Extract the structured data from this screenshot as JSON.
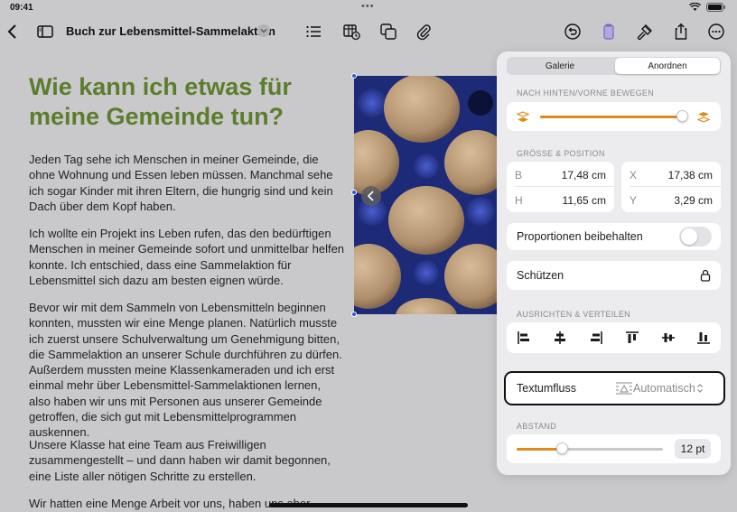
{
  "status": {
    "time": "09:41"
  },
  "toolbar": {
    "doc_title": "Buch zur Lebensmittel-Sammelaktion"
  },
  "document": {
    "heading": "Wie kann ich etwas für meine Gemeinde tun?",
    "paragraphs": [
      "Jeden Tag sehe ich Menschen in meiner Gemeinde, die ohne Wohnung und Essen leben müssen. Manchmal sehe ich sogar Kinder mit ihren Eltern, die hungrig sind und kein Dach über dem Kopf haben.",
      "Ich wollte ein Projekt ins Leben rufen, das den bedürftigen Menschen in meiner Gemeinde sofort und unmittelbar helfen konnte. Ich entschied, dass eine Sammelaktion für Lebensmittel sich dazu am besten eignen würde.",
      "Bevor wir mit dem Sammeln von Lebensmitteln beginnen konnten, mussten wir eine Menge planen. Natürlich musste ich zuerst unsere Schulverwaltung um Genehmigung bitten, die Sammelaktion an unserer Schule durchführen zu dürfen. Außerdem mussten meine Klassenkameraden und ich erst einmal mehr über Lebensmittel-Sammelaktionen lernen, also haben wir uns mit Personen aus unserer Gemeinde getroffen, die sich gut mit Lebensmittelprogrammen auskennen.",
      "Unsere Klasse hat eine Team aus Freiwilligen zusammengestellt – und dann haben wir damit begonnen, eine Liste aller nötigen Schritte zu erstellen.",
      "Wir hatten eine Menge Arbeit vor uns, haben uns aber"
    ]
  },
  "panel": {
    "tabs": {
      "gallery": "Galerie",
      "arrange": "Anordnen"
    },
    "move_label": "NACH HINTEN/VORNE BEWEGEN",
    "move_slider": 0.97,
    "size_label": "GRÖSSE & POSITION",
    "size": {
      "b_label": "B",
      "b_value": "17,48 cm",
      "h_label": "H",
      "h_value": "11,65 cm",
      "x_label": "X",
      "x_value": "17,38 cm",
      "y_label": "Y",
      "y_value": "3,29 cm"
    },
    "proportions_label": "Proportionen beibehalten",
    "proportions_on": false,
    "protect_label": "Schützen",
    "align_label": "AUSRICHTEN & VERTEILEN",
    "textflow_label": "Textumfluss",
    "textflow_value": "Automatisch",
    "spacing_label": "ABSTAND",
    "spacing_value": "12 pt",
    "spacing_slider": 0.31,
    "accent": "#e08a1a"
  },
  "colors": {
    "heading": "#5b7d2c",
    "selection": "#2c5cc9"
  }
}
